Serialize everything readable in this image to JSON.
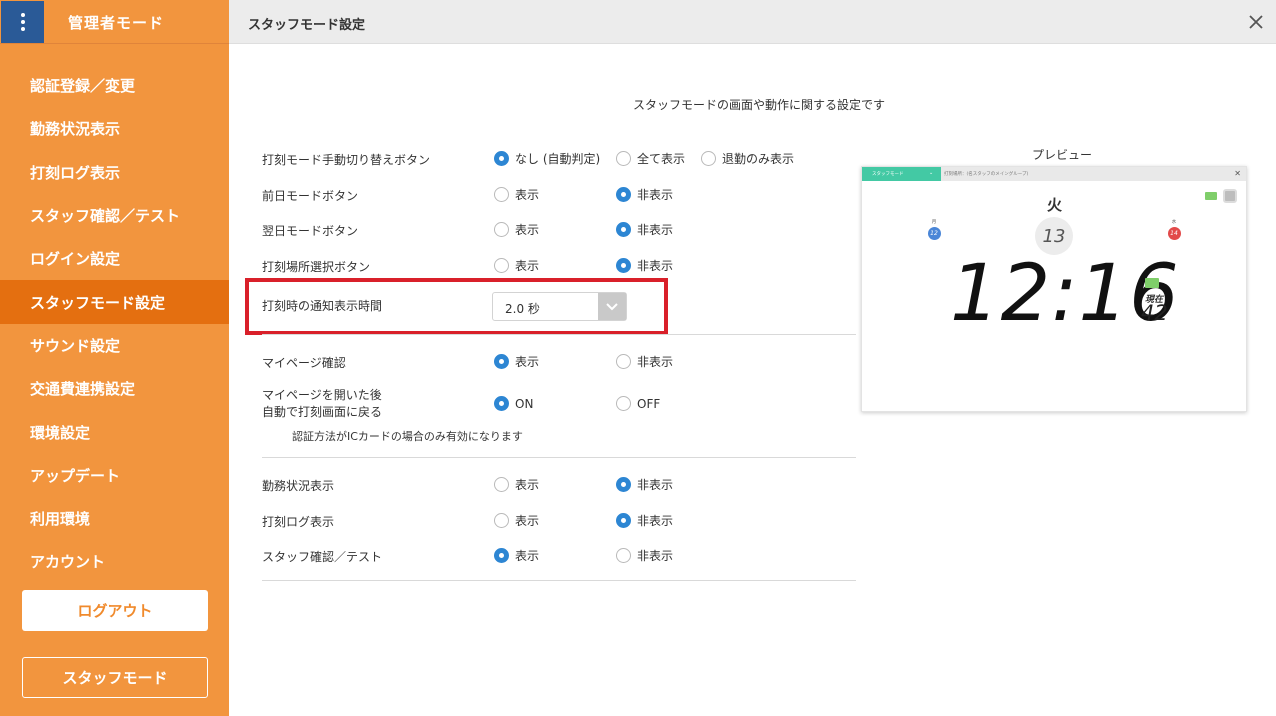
{
  "sidebar": {
    "app_title": "管理者モード",
    "items": [
      {
        "label": "認証登録／変更"
      },
      {
        "label": "勤務状況表示"
      },
      {
        "label": "打刻ログ表示"
      },
      {
        "label": "スタッフ確認／テスト"
      },
      {
        "label": "ログイン設定"
      },
      {
        "label": "スタッフモード設定",
        "active": true
      },
      {
        "label": "サウンド設定"
      },
      {
        "label": "交通費連携設定"
      },
      {
        "label": "環境設定"
      },
      {
        "label": "アップデート"
      },
      {
        "label": "利用環境"
      },
      {
        "label": "アカウント"
      }
    ],
    "logout_label": "ログアウト",
    "staff_mode_label": "スタッフモード"
  },
  "header": {
    "title": "スタッフモード設定",
    "close_icon": "close-icon"
  },
  "main": {
    "description": "スタッフモードの画面や動作に関する設定です",
    "settings": {
      "mode_switch": {
        "label": "打刻モード手動切り替えボタン",
        "options": [
          "なし (自動判定)",
          "全て表示",
          "退勤のみ表示"
        ],
        "selected": "なし (自動判定)"
      },
      "prev_day": {
        "label": "前日モードボタン",
        "options": [
          "表示",
          "非表示"
        ],
        "selected": "非表示"
      },
      "next_day": {
        "label": "翌日モードボタン",
        "options": [
          "表示",
          "非表示"
        ],
        "selected": "非表示"
      },
      "location": {
        "label": "打刻場所選択ボタン",
        "options": [
          "表示",
          "非表示"
        ],
        "selected": "非表示"
      },
      "notify_time": {
        "label": "打刻時の通知表示時間",
        "value": "2.0 秒"
      },
      "mypage": {
        "label": "マイページ確認",
        "options": [
          "表示",
          "非表示"
        ],
        "selected": "表示"
      },
      "mypage_return": {
        "label_line1": "マイページを開いた後",
        "label_line2": "自動で打刻画面に戻る",
        "options": [
          "ON",
          "OFF"
        ],
        "selected": "ON",
        "note": "認証方法がICカードの場合のみ有効になります"
      },
      "work_status": {
        "label": "勤務状況表示",
        "options": [
          "表示",
          "非表示"
        ],
        "selected": "非表示"
      },
      "log": {
        "label": "打刻ログ表示",
        "options": [
          "表示",
          "非表示"
        ],
        "selected": "非表示"
      },
      "staff_check": {
        "label": "スタッフ確認／テスト",
        "options": [
          "表示",
          "非表示"
        ],
        "selected": "表示"
      }
    }
  },
  "preview": {
    "label": "プレビュー",
    "mode_label": "スタッフモード",
    "location_text": "打刻場所：(名スタッフのメイングループ)",
    "weekday": "火",
    "date": "13",
    "prev_label": "月",
    "prev_date": "12",
    "next_label": "水",
    "next_date": "14",
    "time": "12:16",
    "seconds_label": "現在",
    "seconds": "42"
  },
  "colors": {
    "sidebar_bg": "#f2953e",
    "sidebar_active": "#e46f10",
    "menu_button": "#2a5a97",
    "radio_checked": "#2d86d3",
    "highlight": "#d9202a"
  }
}
